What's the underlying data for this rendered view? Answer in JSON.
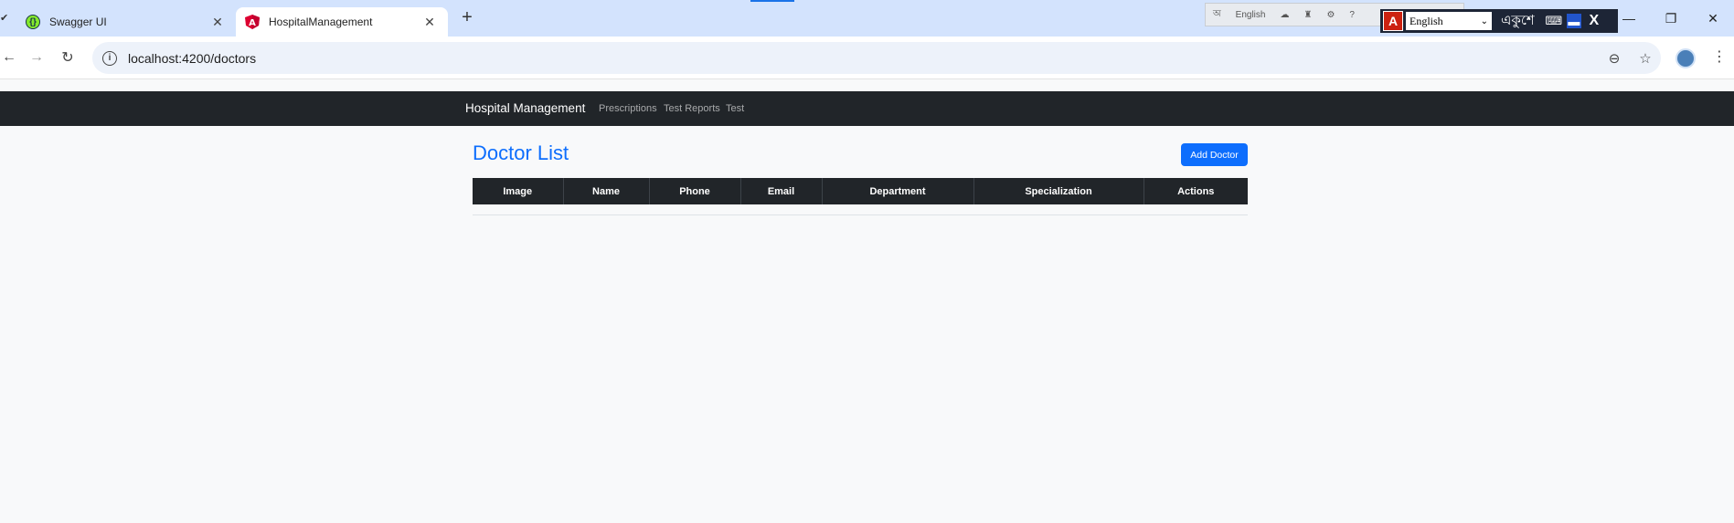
{
  "browser": {
    "tabs": [
      {
        "title": "Swagger UI",
        "favicon": "swagger-icon",
        "active": false
      },
      {
        "title": "HospitalManagement",
        "favicon": "angular-icon",
        "active": true
      }
    ],
    "address": "localhost:4200/doctors"
  },
  "language_bar": {
    "language_label": "English",
    "selected_language": "English",
    "bangla_text": "একুশে"
  },
  "navbar": {
    "brand": "Hospital Management",
    "links": [
      "Prescriptions",
      "Test Reports",
      "Test"
    ]
  },
  "page": {
    "title": "Doctor List",
    "add_button": "Add Doctor"
  },
  "table": {
    "columns": [
      "Image",
      "Name",
      "Phone",
      "Email",
      "Department",
      "Specialization",
      "Actions"
    ],
    "rows": []
  },
  "colors": {
    "primary": "#0d6efd",
    "navbar_bg": "#212529",
    "page_bg": "#f8f9fa",
    "tabstrip_bg": "#d3e3fd"
  }
}
